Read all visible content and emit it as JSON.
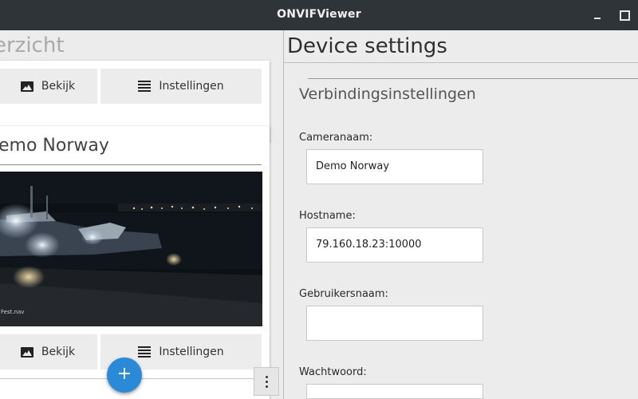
{
  "window": {
    "title": "ONVIFViewer"
  },
  "left": {
    "title": "erzicht",
    "cards": [
      {
        "view_label": "Bekijk",
        "settings_label": "Instellingen"
      },
      {
        "name": "emo Norway",
        "view_label": "Bekijk",
        "settings_label": "Instellingen"
      }
    ],
    "fab_label": "+"
  },
  "right": {
    "title": "Device settings",
    "section": "Verbindingsinstellingen",
    "fields": [
      {
        "label": "Cameranaam:",
        "value": "Demo Norway"
      },
      {
        "label": "Hostname:",
        "value": "79.160.18.23:10000"
      },
      {
        "label": "Gebruikersnaam:",
        "value": ""
      },
      {
        "label": "Wachtwoord:",
        "value": ""
      }
    ]
  },
  "camera_overlay_text": "Fest.nav",
  "colors": {
    "titlebar": "#2f3438",
    "accent": "#2b8ad8",
    "background": "#ececec"
  },
  "icons": [
    "image-icon",
    "list-icon",
    "plus-icon",
    "more-vertical-icon",
    "minimize-icon",
    "maximize-icon"
  ]
}
